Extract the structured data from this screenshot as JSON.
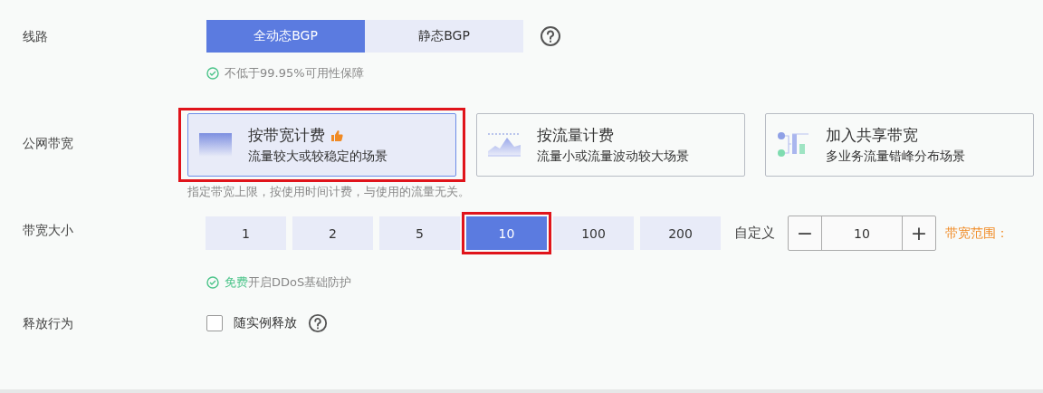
{
  "line": {
    "label": "线路",
    "options": [
      {
        "label": "全动态BGP",
        "selected": true
      },
      {
        "label": "静态BGP",
        "selected": false
      }
    ],
    "note": "不低于99.95%可用性保障"
  },
  "bandwidth": {
    "label": "公网带宽",
    "cards": [
      {
        "kind": "bandwidth",
        "title": "按带宽计费",
        "recommended": true,
        "subtitle": "流量较大或较稳定的场景",
        "selected": true,
        "highlighted": true
      },
      {
        "kind": "traffic",
        "title": "按流量计费",
        "recommended": false,
        "subtitle": "流量小或流量波动较大场景",
        "selected": false,
        "highlighted": false
      },
      {
        "kind": "shared",
        "title": "加入共享带宽",
        "recommended": false,
        "subtitle": "多业务流量错峰分布场景",
        "selected": false,
        "highlighted": false
      }
    ],
    "note": "指定带宽上限，按使用时间计费，与使用的流量无关。"
  },
  "size": {
    "label": "带宽大小",
    "options": [
      {
        "label": "1",
        "selected": false,
        "highlighted": false
      },
      {
        "label": "2",
        "selected": false,
        "highlighted": false
      },
      {
        "label": "5",
        "selected": false,
        "highlighted": false
      },
      {
        "label": "10",
        "selected": true,
        "highlighted": true
      },
      {
        "label": "100",
        "selected": false,
        "highlighted": false
      },
      {
        "label": "200",
        "selected": false,
        "highlighted": false
      }
    ],
    "custom_label": "自定义",
    "minus": "−",
    "value": "10",
    "plus": "+",
    "range_label": "带宽范围：",
    "note": [
      {
        "text": "免费",
        "accent": true
      },
      {
        "text": "开启DDoS基础防护",
        "accent": false
      }
    ]
  },
  "release": {
    "label": "释放行为",
    "checkbox": {
      "label": "随实例释放",
      "checked": false
    }
  }
}
